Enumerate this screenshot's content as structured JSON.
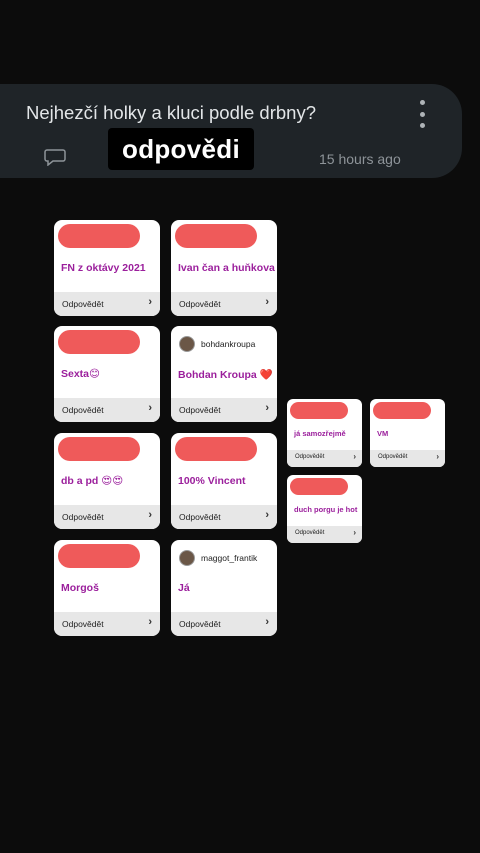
{
  "question": {
    "title": "Nejhezčí holky a kluci podle drbny?",
    "badge": "odpovědi",
    "time": "15 hours ago"
  },
  "icons": {
    "comment": "speech-bubble-icon",
    "more": "more-vertical-icon",
    "chevron": "chevron-right-icon"
  },
  "cards": [
    {
      "answer": "FN z oktávy 2021",
      "reply": "Odpovědět",
      "chevron": "›"
    },
    {
      "answer": "Ivan čan a huňkova",
      "reply": "Odpovědět",
      "chevron": "›"
    },
    {
      "answer": "Sexta😊",
      "reply": "Odpovědět",
      "chevron": "›"
    },
    {
      "user": "bohdankroupa",
      "answer": "Bohdan Kroupa ❤️",
      "reply": "Odpovědět",
      "chevron": "›"
    },
    {
      "answer": "db a pd 😍😍",
      "reply": "Odpovědět",
      "chevron": "›"
    },
    {
      "answer": "100% Vincent",
      "reply": "Odpovědět",
      "chevron": "›"
    },
    {
      "answer": "Morgoš",
      "reply": "Odpovědět",
      "chevron": "›"
    },
    {
      "user": "maggot_frantik",
      "answer": "Já",
      "reply": "Odpovědět",
      "chevron": "›"
    },
    {
      "answer": "já samozřejmě",
      "reply": "Odpovědět",
      "chevron": "›"
    },
    {
      "answer": "VM",
      "reply": "Odpovědět",
      "chevron": "›"
    },
    {
      "answer": "duch porgu je hot",
      "reply": "Odpovědět",
      "chevron": "›"
    }
  ],
  "colors": {
    "answer": "#9b1f9c",
    "redaction": "#ef5a5a",
    "header_bg": "#1f2428"
  }
}
